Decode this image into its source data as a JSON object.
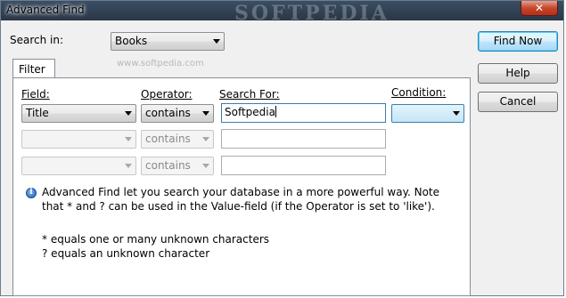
{
  "window": {
    "title": "Advanced Find",
    "watermark": "SOFTPEDIA",
    "close_icon": "close-icon"
  },
  "search_in": {
    "label": "Search in:",
    "value": "Books",
    "watermark_url": "www.softpedia.com"
  },
  "buttons": {
    "find_now": "Find Now",
    "help": "Help",
    "cancel": "Cancel"
  },
  "filter": {
    "tab_label": "Filter",
    "field_header": "Field:",
    "operator_header": "Operator:",
    "search_for_header": "Search For:",
    "condition_header": "Condition:",
    "rows": [
      {
        "field": "Title",
        "operator": "contains",
        "search_for": "Softpedia",
        "condition": ""
      },
      {
        "field": "",
        "operator": "contains",
        "search_for": "",
        "condition": ""
      },
      {
        "field": "",
        "operator": "contains",
        "search_for": "",
        "condition": ""
      }
    ]
  },
  "info": {
    "icon": "info-icon",
    "line1": "Advanced Find let you search your database in a more powerful way. Note",
    "line2": "that * and ? can be used in the Value-field (if the Operator is set to 'like').",
    "line3": "* equals one or many unknown characters",
    "line4": "? equals an unknown character"
  }
}
